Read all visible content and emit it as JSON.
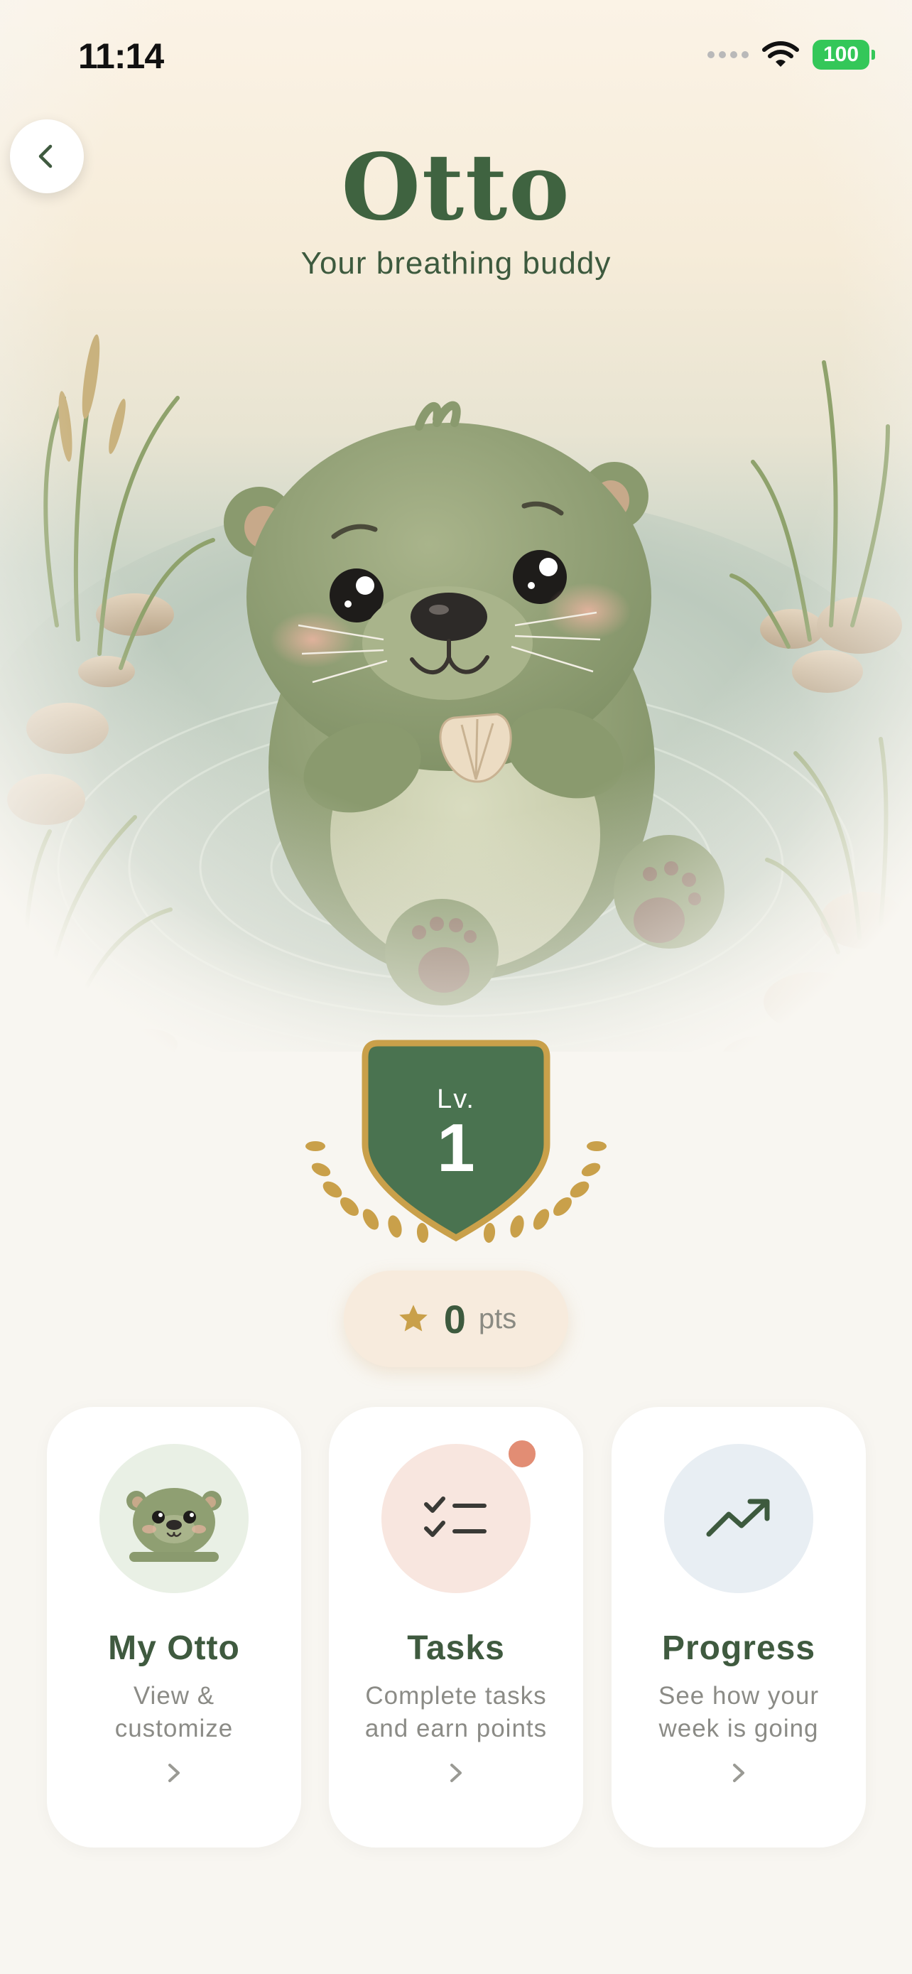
{
  "status_bar": {
    "time": "11:14",
    "battery": "100"
  },
  "header": {
    "title": "Otto",
    "subtitle": "Your breathing buddy"
  },
  "level": {
    "label": "Lv.",
    "value": "1"
  },
  "points": {
    "value": "0",
    "unit": "pts"
  },
  "cards": [
    {
      "title": "My Otto",
      "description_line1": "View &",
      "description_line2": "customize"
    },
    {
      "title": "Tasks",
      "description_line1": "Complete tasks",
      "description_line2": "and earn points",
      "has_notification": true
    },
    {
      "title": "Progress",
      "description_line1": "See how your",
      "description_line2": "week is going"
    }
  ],
  "icons": {
    "back": "chevron-left-icon",
    "star": "star-icon",
    "tasks": "checklist-icon",
    "progress": "trending-up-icon",
    "chevron": "chevron-right-icon"
  },
  "colors": {
    "primary_green": "#3f6340",
    "badge_green": "#4a7350",
    "gold": "#c9a04a",
    "notification": "#e28d74",
    "card_bg": "#ffffff",
    "tasks_circle": "#f8e6df",
    "progress_circle": "#e8eef3",
    "otto_circle": "#e9f0e5"
  }
}
